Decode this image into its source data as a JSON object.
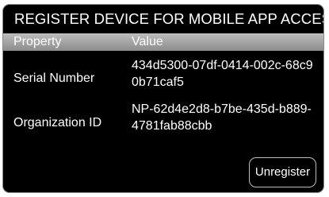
{
  "dialog": {
    "title": "REGISTER DEVICE FOR MOBILE APP ACCESS"
  },
  "table": {
    "headers": {
      "property": "Property",
      "value": "Value"
    },
    "rows": [
      {
        "property": "Serial Number",
        "value": "434d5300-07df-0414-002c-68c90b71caf5"
      },
      {
        "property": "Organization ID",
        "value": "NP-62d4e2d8-b7be-435d-b889-4781fab88cbb"
      }
    ]
  },
  "actions": {
    "unregister_label": "Unregister"
  },
  "colors": {
    "background": "#000000",
    "header_bar": "#a6a6a6",
    "text": "#ffffff",
    "border": "#8a8a8a"
  }
}
